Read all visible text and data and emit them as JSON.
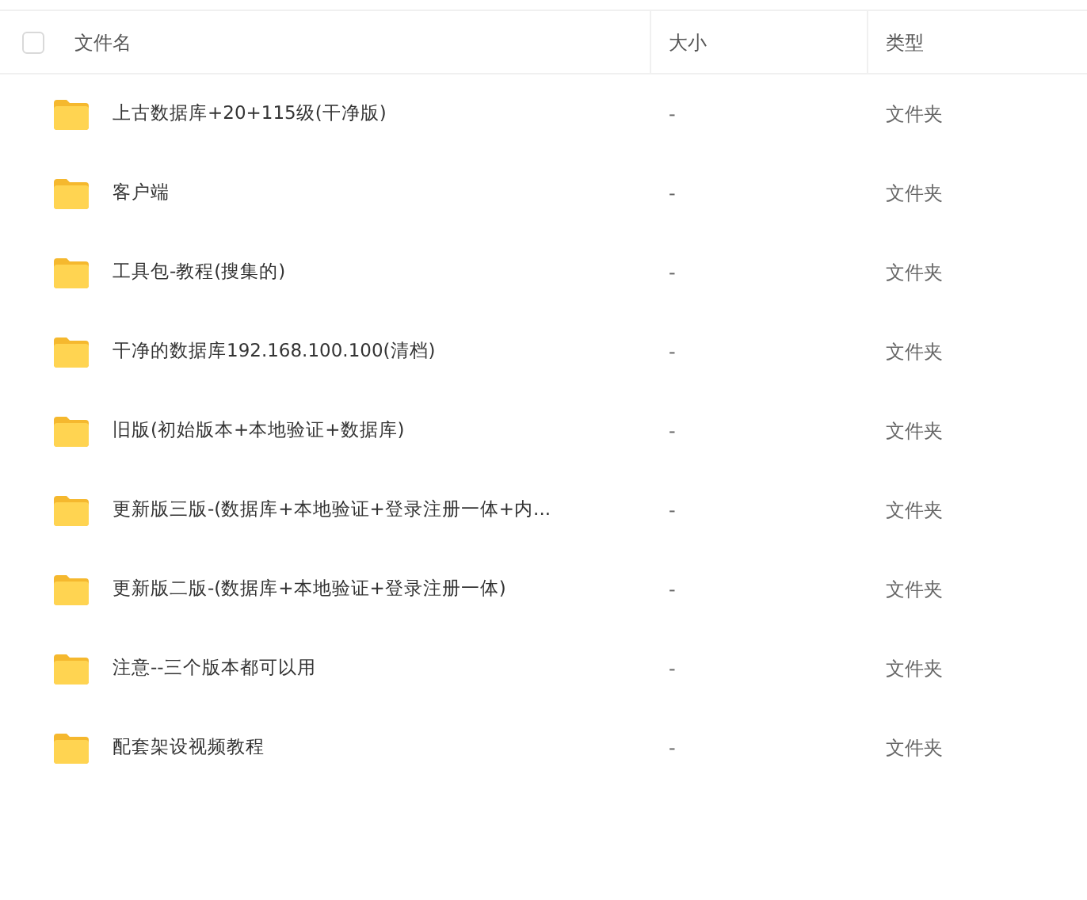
{
  "header": {
    "select_all": {
      "checked": false
    },
    "columns": [
      "文件名",
      "大小",
      "类型"
    ]
  },
  "rows": [
    {
      "name": "上古数据库+20+115级(干净版)",
      "size": "-",
      "type": "文件夹"
    },
    {
      "name": "客户端",
      "size": "-",
      "type": "文件夹"
    },
    {
      "name": "工具包-教程(搜集的)",
      "size": "-",
      "type": "文件夹"
    },
    {
      "name": "干净的数据库192.168.100.100(清档)",
      "size": "-",
      "type": "文件夹"
    },
    {
      "name": "旧版(初始版本+本地验证+数据库)",
      "size": "-",
      "type": "文件夹"
    },
    {
      "name": "更新版三版-(数据库+本地验证+登录注册一体+内...",
      "size": "-",
      "type": "文件夹"
    },
    {
      "name": "更新版二版-(数据库+本地验证+登录注册一体)",
      "size": "-",
      "type": "文件夹"
    },
    {
      "name": "注意--三个版本都可以用",
      "size": "-",
      "type": "文件夹"
    },
    {
      "name": "配套架设视频教程",
      "size": "-",
      "type": "文件夹"
    }
  ]
}
